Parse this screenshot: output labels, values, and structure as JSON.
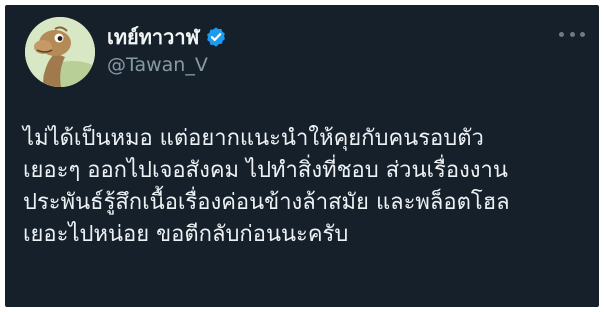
{
  "author": {
    "display_name": "เทย์ทาวาฬ",
    "handle": "@Tawan_V",
    "verified": true,
    "avatar_icon": "dinosaur-cartoon-avatar"
  },
  "menu": {
    "icon": "more-horizontal-icon"
  },
  "tweet": {
    "lines": [
      "ไม่ได้เป็นหมอ แต่อยากแนะนำให้คุยกับคนรอบตัว",
      "เยอะๆ ออกไปเจอสังคม ไปทำสิ่งที่ชอบ ส่วนเรื่องงาน",
      "ประพันธ์รู้สึกเนื้อเรื่องค่อนข้างล้าสมัย และพล็อตโฮล",
      "เยอะไปหน่อย ขอตีกลับก่อนนะครับ"
    ]
  },
  "colors": {
    "background": "#15202b",
    "text": "#eef1f3",
    "secondary_text": "#8899a6",
    "verified_badge": "#1d9bf0"
  }
}
